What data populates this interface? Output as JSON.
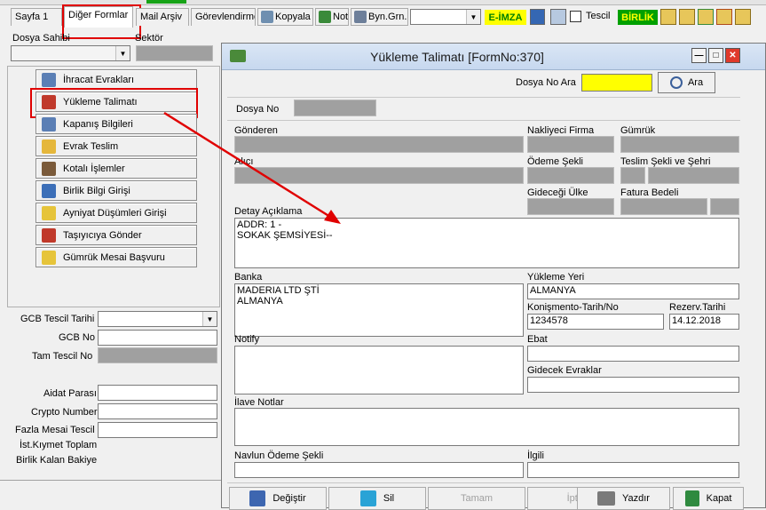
{
  "tabs": [
    "Sayfa 1",
    "Diğer Formlar",
    "Mail Arşiv",
    "Görevlendirme"
  ],
  "toolbar": {
    "kopyala": "Kopyala",
    "not": "Not",
    "byn": "Byn.Grn.",
    "eimza": "E-İMZA",
    "tescil": "Tescil",
    "birlik": "BİRLİK"
  },
  "left": {
    "dosya_sahibi": "Dosya Sahibi",
    "sektor": "Sektör",
    "buttons": [
      "İhracat Evrakları",
      "Yükleme Talimatı",
      "Kapanış Bilgileri",
      "Evrak Teslim",
      "Kotalı İşlemler",
      "Birlik Bilgi Girişi",
      "Ayniyat Düşümleri Girişi",
      "Taşıyıcıya Gönder",
      "Gümrük Mesai Başvuru"
    ],
    "gcb_tescil_tarihi": "GCB Tescil Tarihi",
    "gcb_no": "GCB No",
    "tam_tescil_no": "Tam Tescil No",
    "aidat_parasi": "Aidat Parası",
    "crypto_number": "Crypto Number",
    "fazla_mesai_tescil": "Fazla Mesai Tescil",
    "ist_kiymet_toplam": "İst.Kıymet Toplam",
    "birlik_kalan_bakiye": "Birlik Kalan Bakiye"
  },
  "dialog": {
    "title": "Yükleme Talimatı [FormNo:370]",
    "dosya_no_ara": "Dosya No Ara",
    "ara": "Ara",
    "dosya_no": "Dosya No",
    "gonderen": "Gönderen",
    "nakliyeci_firma": "Nakliyeci Firma",
    "gumruk": "Gümrük",
    "alici": "Alıcı",
    "odeme_sekli": "Ödeme Şekli",
    "teslim_sekli": "Teslim Şekli ve Şehri",
    "gidecegi_ulke": "Gideceği Ülke",
    "fatura_bedeli": "Fatura Bedeli",
    "detay_aciklama": "Detay Açıklama",
    "detay_value": "ADDR: 1 -\nSOKAK ŞEMSİYESİ--",
    "banka": "Banka",
    "banka_value": "MADERIA LTD ŞTİ\nALMANYA",
    "yukleme_yeri": "Yükleme Yeri",
    "yukleme_yeri_value": "ALMANYA",
    "konismento": "Konişmento-Tarih/No",
    "konismento_value": "1234578",
    "rezerv_tarihi": "Rezerv.Tarihi",
    "rezerv_value": "14.12.2018",
    "notify": "Notify",
    "ebat": "Ebat",
    "gidecek_evraklar": "Gidecek Evraklar",
    "ilave_notlar": "İlave Notlar",
    "navlun": "Navlun Ödeme Şekli",
    "ilgili": "İlgili",
    "btn_degistir": "Değiştir",
    "btn_sil": "Sil",
    "btn_tamam": "Tamam",
    "btn_iptal": "İptal",
    "btn_yazdir": "Yazdır",
    "btn_kapat": "Kapat"
  },
  "colors": {
    "highlight": "#e00000",
    "search": "#ffff00",
    "disabled_field": "#a0a0a0",
    "eimza": "#ffff00",
    "birlik": "#00a000"
  }
}
